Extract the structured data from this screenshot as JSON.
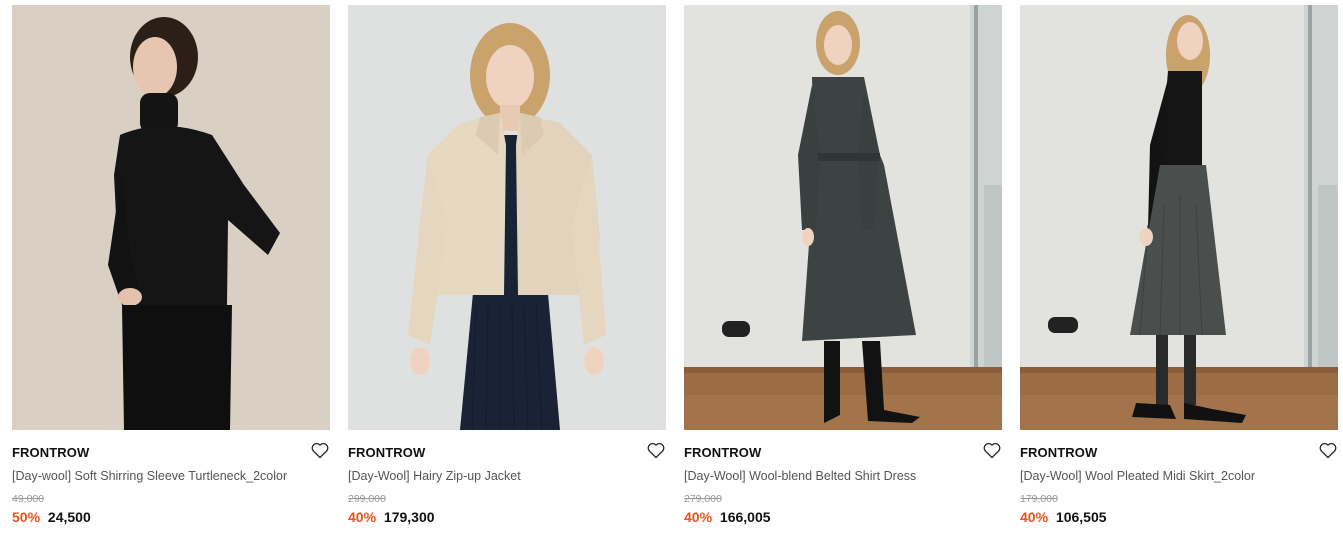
{
  "products": [
    {
      "brand": "FRONTROW",
      "title": "[Day-wool] Soft Shirring Sleeve Turtleneck_2color",
      "original_price": "49,000",
      "discount": "50%",
      "sale_price": "24,500",
      "bg_color": "#d9cfc3",
      "garment_color": "#151515"
    },
    {
      "brand": "FRONTROW",
      "title": "[Day-Wool] Hairy Zip-up Jacket",
      "original_price": "299,000",
      "discount": "40%",
      "sale_price": "179,300",
      "bg_color": "#dfe1e0",
      "garment_color": "#e7d8c2"
    },
    {
      "brand": "FRONTROW",
      "title": "[Day-Wool] Wool-blend Belted Shirt Dress",
      "original_price": "279,000",
      "discount": "40%",
      "sale_price": "166,005",
      "bg_color": "#e2e2df",
      "garment_color": "#3d4343"
    },
    {
      "brand": "FRONTROW",
      "title": "[Day-Wool] Wool Pleated Midi Skirt_2color",
      "original_price": "179,000",
      "discount": "40%",
      "sale_price": "106,505",
      "bg_color": "#e2e2df",
      "garment_color": "#4a4f4d"
    }
  ],
  "icons": {
    "wishlist": "heart-outline-icon"
  },
  "colors": {
    "discount": "#e8541a",
    "brand_text": "#111111",
    "title_text": "#555555",
    "strike_text": "#999999"
  }
}
